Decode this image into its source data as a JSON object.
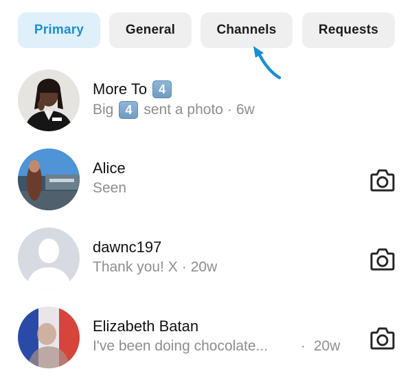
{
  "tabs": [
    {
      "label": "Primary",
      "active": true
    },
    {
      "label": "General",
      "active": false
    },
    {
      "label": "Channels",
      "active": false
    },
    {
      "label": "Requests",
      "active": false
    }
  ],
  "colors": {
    "accent": "#1b8fd4",
    "active_tab_bg": "#dff0fb",
    "tab_bg": "#efefef",
    "secondary_text": "#8e8e8e",
    "arrow": "#1b8fd4"
  },
  "annotation": {
    "icon": "arrow-pointing-icon"
  },
  "threads": [
    {
      "name": "More To",
      "name_badge": "4",
      "sub_prefix": "Big",
      "sub_badge": "4",
      "sub_text": "sent a photo",
      "separator": "·",
      "time": "6w",
      "camera": false
    },
    {
      "name": "Alice",
      "sub_text": "Seen",
      "camera": true,
      "camera_icon": "camera-icon"
    },
    {
      "name": "dawnc197",
      "sub_text": "Thank you! X",
      "separator": "·",
      "time": "20w",
      "camera": true,
      "camera_icon": "camera-icon"
    },
    {
      "name": "Elizabeth Batan",
      "sub_text": "I've been doing chocolate...",
      "separator": "·",
      "time": "20w",
      "camera": true,
      "camera_icon": "camera-icon"
    }
  ]
}
